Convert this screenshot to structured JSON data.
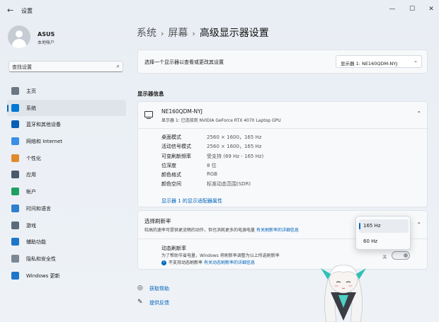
{
  "window": {
    "title": "设置",
    "back_icon": "back-arrow-icon",
    "controls": {
      "minimize": "—",
      "maximize": "☐",
      "close": "✕"
    }
  },
  "profile": {
    "name": "ASUS",
    "account": "本地帐户"
  },
  "search": {
    "placeholder": "查找设置"
  },
  "nav": [
    {
      "label": "主页",
      "icon": "home-icon",
      "color": "#6b7785"
    },
    {
      "label": "系统",
      "icon": "system-icon",
      "color": "#0078d4",
      "active": true
    },
    {
      "label": "蓝牙和其他设备",
      "icon": "bluetooth-icon",
      "color": "#0a5fb4"
    },
    {
      "label": "网络和 Internet",
      "icon": "wifi-icon",
      "color": "#3a8ee6"
    },
    {
      "label": "个性化",
      "icon": "brush-icon",
      "color": "#e08a2c"
    },
    {
      "label": "应用",
      "icon": "apps-icon",
      "color": "#4a5a6c"
    },
    {
      "label": "帐户",
      "icon": "account-icon",
      "color": "#20a060"
    },
    {
      "label": "时间和语言",
      "icon": "globe-icon",
      "color": "#2f7fd0"
    },
    {
      "label": "游戏",
      "icon": "game-icon",
      "color": "#5c6b7a"
    },
    {
      "label": "辅助功能",
      "icon": "accessibility-icon",
      "color": "#1f76c8"
    },
    {
      "label": "隐私和安全性",
      "icon": "shield-icon",
      "color": "#7a8794"
    },
    {
      "label": "Windows 更新",
      "icon": "update-icon",
      "color": "#1f76c8"
    }
  ],
  "breadcrumb": {
    "part1": "系统",
    "part2": "屏幕",
    "current": "高级显示器设置",
    "separator": "›"
  },
  "display_select": {
    "label": "选择一个显示器以查看或更改其设置",
    "value": "显示器 1: NE160QDM-NYJ"
  },
  "section_title": "显示器信息",
  "monitor": {
    "name": "NE160QDM-NYJ",
    "subtitle": "显示器 1: 已连接到 NVIDIA GeForce RTX 4070 Laptop GPU",
    "rows": [
      {
        "key": "桌面模式",
        "value": "2560 × 1600，165 Hz"
      },
      {
        "key": "活动信号模式",
        "value": "2560 × 1600，165 Hz"
      },
      {
        "key": "可变刷新频率",
        "value": "受支持 (69 Hz - 165 Hz)"
      },
      {
        "key": "位深度",
        "value": "8 位"
      },
      {
        "key": "颜色格式",
        "value": "RGB"
      },
      {
        "key": "颜色空间",
        "value": "标准动态范围(SDR)"
      }
    ],
    "adapter_link": "显示器 1 的显示适配器属性"
  },
  "refresh": {
    "title": "选择刷新率",
    "desc": "较高的速率可提供更流畅的动作，但也消耗更多的电源电量",
    "desc_link": "有关刷新率的详细信息",
    "options": [
      "165 Hz",
      "60 Hz"
    ],
    "selected": "165 Hz",
    "dynamic": {
      "title": "动态刷新率",
      "desc": "为了帮助节省电量，Windows 将刷新率调整为以上所选刷新率",
      "note": "不支持动态刷新率",
      "note_link": "有关动态刷新率的详细信息",
      "toggle_label": "关",
      "toggle_on": false
    }
  },
  "help": [
    {
      "label": "获取帮助",
      "icon": "help-icon"
    },
    {
      "label": "提供反馈",
      "icon": "feedback-icon"
    }
  ]
}
